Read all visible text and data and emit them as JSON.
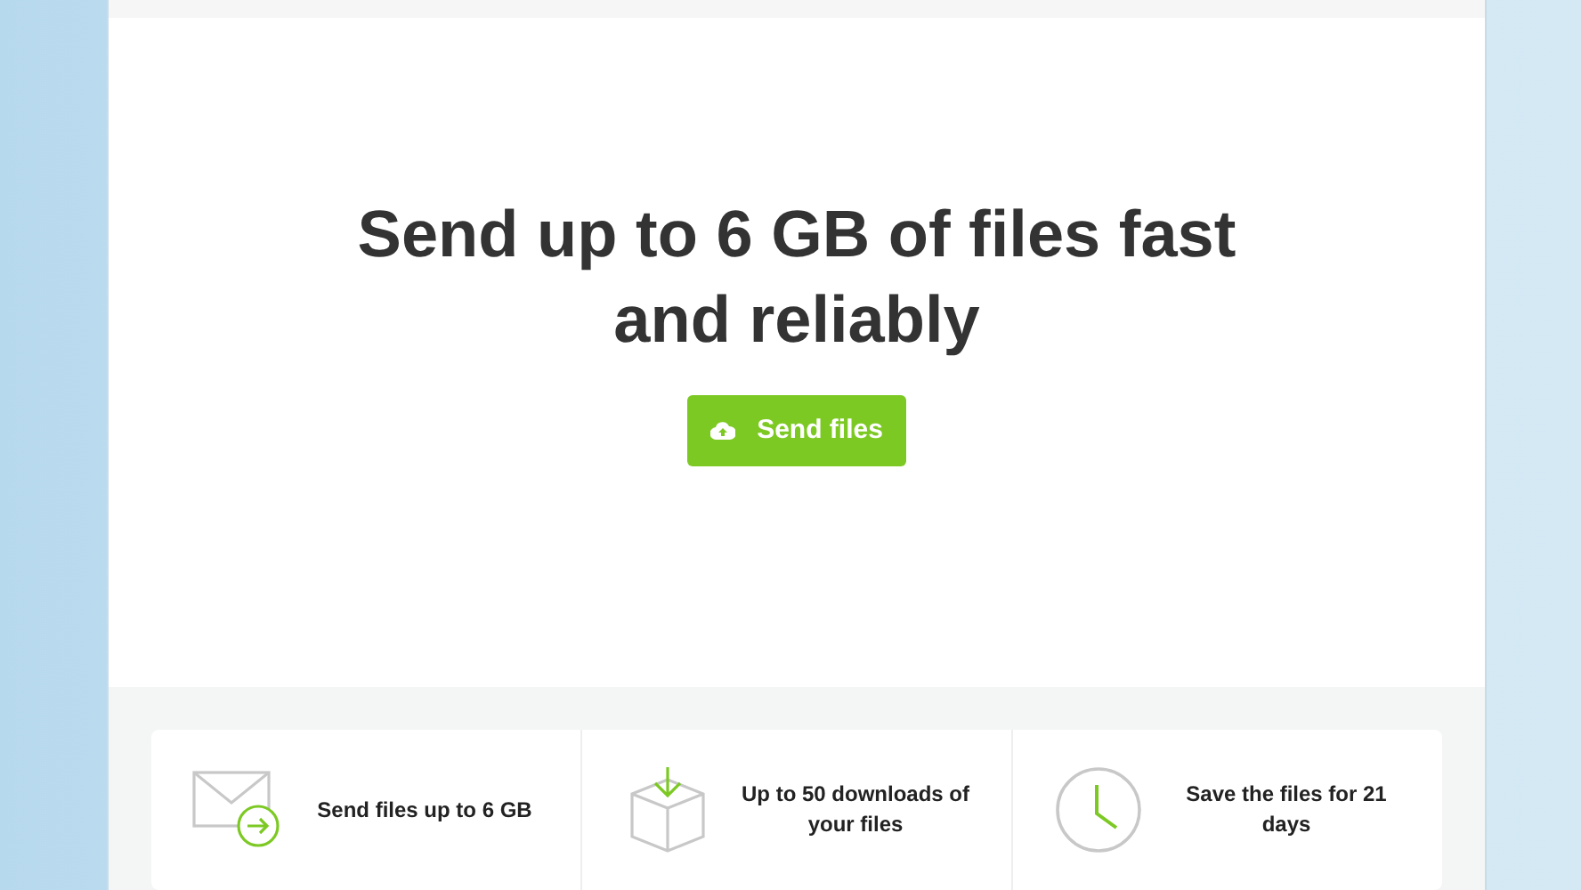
{
  "hero": {
    "title": "Send up to 6 GB of files fast and reliably",
    "button": "Send files"
  },
  "features": [
    {
      "kind": "mail",
      "text": "Send files up to 6 GB"
    },
    {
      "kind": "download",
      "text": "Up to 50 downloads of your files"
    },
    {
      "kind": "clock",
      "text": "Save the files for 21 days"
    }
  ]
}
